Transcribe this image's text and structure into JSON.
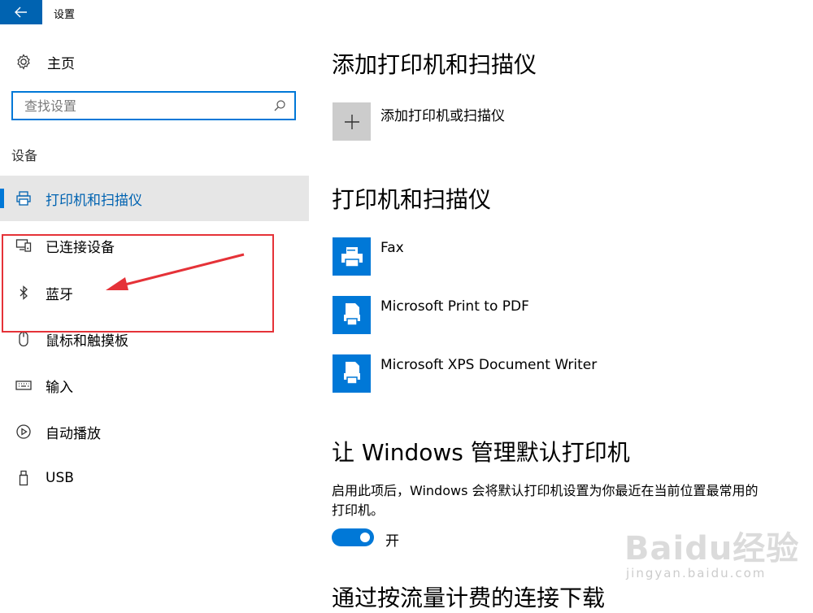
{
  "titlebar": {
    "title": "设置"
  },
  "sidebar": {
    "home_label": "主页",
    "search_placeholder": "查找设置",
    "section_label": "设备",
    "items": [
      {
        "label": "打印机和扫描仪",
        "icon": "printer-icon",
        "selected": true
      },
      {
        "label": "已连接设备",
        "icon": "connected-devices-icon",
        "selected": false
      },
      {
        "label": "蓝牙",
        "icon": "bluetooth-icon",
        "selected": false
      },
      {
        "label": "鼠标和触摸板",
        "icon": "mouse-icon",
        "selected": false
      },
      {
        "label": "输入",
        "icon": "keyboard-icon",
        "selected": false
      },
      {
        "label": "自动播放",
        "icon": "autoplay-icon",
        "selected": false
      },
      {
        "label": "USB",
        "icon": "usb-icon",
        "selected": false
      }
    ]
  },
  "main": {
    "add_heading": "添加打印机和扫描仪",
    "add_label": "添加打印机或扫描仪",
    "printers_heading": "打印机和扫描仪",
    "printers": [
      {
        "name": "Fax",
        "icon": "fax-icon"
      },
      {
        "name": "Microsoft Print to PDF",
        "icon": "pdf-printer-icon"
      },
      {
        "name": "Microsoft XPS Document Writer",
        "icon": "xps-printer-icon"
      }
    ],
    "default_heading": "让 Windows 管理默认打印机",
    "default_desc": "启用此项后，Windows 会将默认打印机设置为你最近在当前位置最常用的打印机。",
    "toggle_label": "开",
    "toggle_on": true,
    "metered_heading": "通过按流量计费的连接下载"
  },
  "watermark": {
    "logo": "Baidu经验",
    "url": "jingyan.baidu.com"
  },
  "colors": {
    "accent": "#0078d7",
    "annotation": "#e53238",
    "selected_bg": "#e6e6e6"
  }
}
